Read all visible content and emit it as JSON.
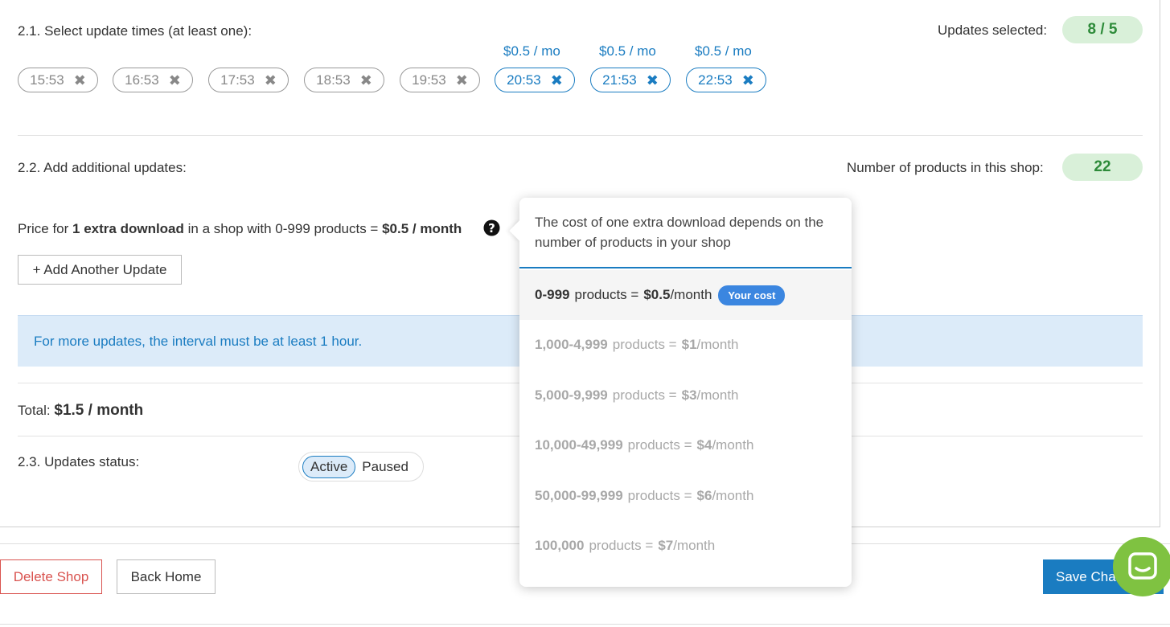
{
  "section_times": {
    "label": "2.1. Select update times (at least one):",
    "selected_label": "Updates selected:",
    "selected_value": "8 / 5",
    "chips": [
      {
        "time": "15:53",
        "paid": false,
        "price": ""
      },
      {
        "time": "16:53",
        "paid": false,
        "price": ""
      },
      {
        "time": "17:53",
        "paid": false,
        "price": ""
      },
      {
        "time": "18:53",
        "paid": false,
        "price": ""
      },
      {
        "time": "19:53",
        "paid": false,
        "price": ""
      },
      {
        "time": "20:53",
        "paid": true,
        "price": "$0.5 / mo"
      },
      {
        "time": "21:53",
        "paid": true,
        "price": "$0.5 / mo"
      },
      {
        "time": "22:53",
        "paid": true,
        "price": "$0.5 / mo"
      }
    ],
    "remove_glyph": "✖"
  },
  "section_additional": {
    "label": "2.2. Add additional updates:",
    "products_label": "Number of products in this shop:",
    "products_value": "22",
    "price_prefix": "Price for ",
    "price_bold1": "1 extra download",
    "price_mid": " in a shop with 0-999 products = ",
    "price_bold2": "$0.5 / month",
    "add_button": "+ Add Another Update"
  },
  "info_message": "For more updates, the interval must be at least 1 hour.",
  "total": {
    "label": "Total:",
    "value": "$1.5 / month"
  },
  "status": {
    "label": "2.3. Updates status:",
    "active": "Active",
    "paused": "Paused"
  },
  "footer": {
    "delete": "Delete Shop",
    "back": "Back Home",
    "save": "Save Cha"
  },
  "popover": {
    "text": "The cost of one extra download depends on the number of products in your shop",
    "tiers": [
      {
        "range": "0-999",
        "price": "$0.5",
        "current": true
      },
      {
        "range": "1,000-4,999",
        "price": "$1",
        "current": false
      },
      {
        "range": "5,000-9,999",
        "price": "$3",
        "current": false
      },
      {
        "range": "10,000-49,999",
        "price": "$4",
        "current": false
      },
      {
        "range": "50,000-99,999",
        "price": "$6",
        "current": false
      },
      {
        "range": "100,000",
        "price": "$7",
        "current": false
      }
    ],
    "products_word": "products =",
    "per_month": "/month",
    "badge": "Your cost"
  },
  "colors": {
    "accent": "#1a7cc1",
    "green": "#2e8b3a",
    "danger": "#d9534f",
    "chat": "#7fc241"
  }
}
